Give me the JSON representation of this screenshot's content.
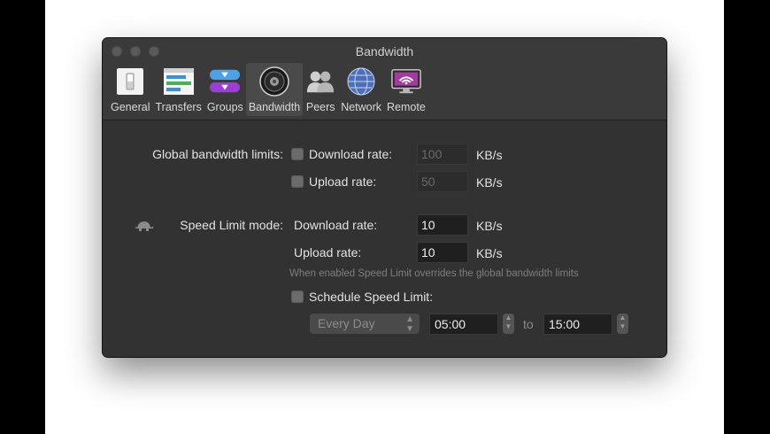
{
  "window": {
    "title": "Bandwidth"
  },
  "toolbar": {
    "items": [
      {
        "label": "General",
        "icon": "switch-icon"
      },
      {
        "label": "Transfers",
        "icon": "transfers-icon"
      },
      {
        "label": "Groups",
        "icon": "groups-icon"
      },
      {
        "label": "Bandwidth",
        "icon": "speaker-icon",
        "active": true
      },
      {
        "label": "Peers",
        "icon": "peers-icon"
      },
      {
        "label": "Network",
        "icon": "globe-icon"
      },
      {
        "label": "Remote",
        "icon": "remote-icon"
      }
    ]
  },
  "global": {
    "label": "Global bandwidth limits:",
    "download_label": "Download rate:",
    "download_value": "100",
    "upload_label": "Upload rate:",
    "upload_value": "50",
    "unit": "KB/s"
  },
  "speed_limit": {
    "label": "Speed Limit mode:",
    "download_label": "Download rate:",
    "download_value": "10",
    "upload_label": "Upload rate:",
    "upload_value": "10",
    "unit": "KB/s",
    "note": "When enabled Speed Limit overrides the global bandwidth limits"
  },
  "schedule": {
    "label": "Schedule Speed Limit:",
    "day": "Every Day",
    "from": "05:00",
    "to_label": "to",
    "to": "15:00"
  }
}
